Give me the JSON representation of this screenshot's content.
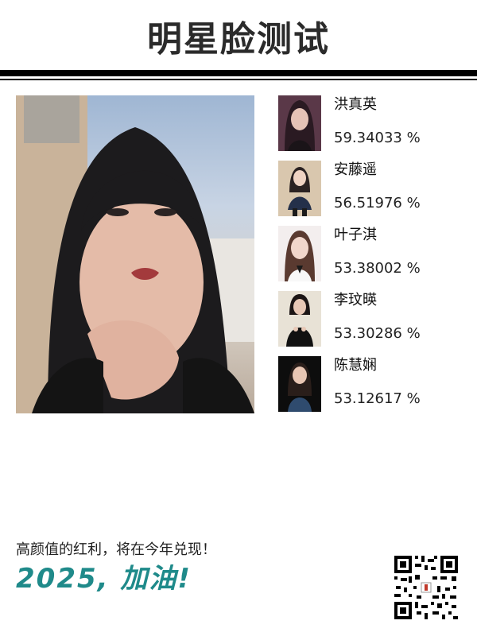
{
  "header": {
    "title": "明星脸测试"
  },
  "main_photo": {
    "icon": "portrait-photo"
  },
  "matches": [
    {
      "name": "洪真英",
      "score": "59.34033 %",
      "icon": "celebrity-thumbnail"
    },
    {
      "name": "安藤遥",
      "score": "56.51976 %",
      "icon": "celebrity-thumbnail"
    },
    {
      "name": "叶子淇",
      "score": "53.38002 %",
      "icon": "celebrity-thumbnail"
    },
    {
      "name": "李玟暎",
      "score": "53.30286 %",
      "icon": "celebrity-thumbnail"
    },
    {
      "name": "陈慧娴",
      "score": "53.12617 %",
      "icon": "celebrity-thumbnail"
    }
  ],
  "footer": {
    "slogan": "高颜值的红利，将在今年兑现！",
    "cheer": "2025, 加油!"
  },
  "qr": {
    "icon": "qr-code"
  },
  "colors": {
    "accent": "#1f8a8a",
    "title": "#2b2b2b"
  }
}
